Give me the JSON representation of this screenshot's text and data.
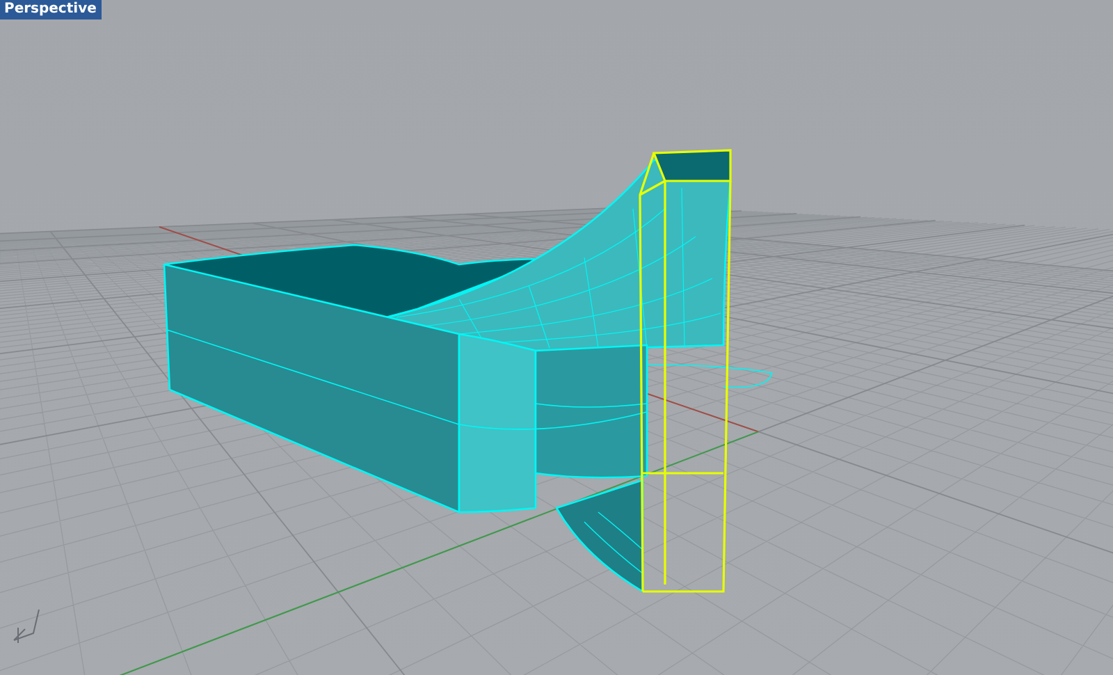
{
  "viewport": {
    "title": "Perspective",
    "active": true
  }
}
